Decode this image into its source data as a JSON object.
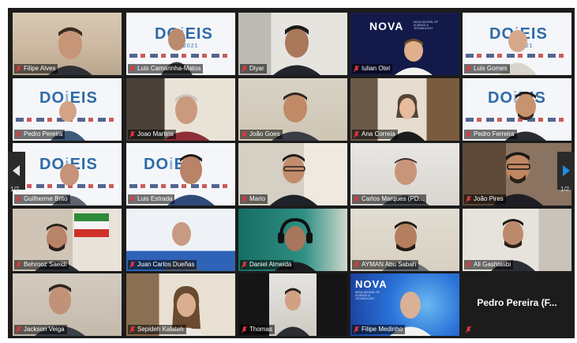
{
  "app": {
    "name": "Zoom gallery view"
  },
  "pagination": {
    "left_page": "1/2",
    "right_page": "1/2"
  },
  "participants": [
    {
      "name": "Filipe Alves",
      "background": "room",
      "muted": true
    },
    {
      "name": "Luis Camarinha-Matos",
      "background": "doceis-banner",
      "muted": true
    },
    {
      "name": "Diyar",
      "background": "room",
      "muted": true
    },
    {
      "name": "Iulian Otel",
      "background": "nova-banner",
      "muted": true
    },
    {
      "name": "Luis Gomes",
      "background": "doceis-banner",
      "muted": true
    },
    {
      "name": "Pedro Pereira",
      "background": "doceis-banner",
      "muted": true,
      "speaking": true
    },
    {
      "name": "Joao Martins",
      "background": "room",
      "muted": true
    },
    {
      "name": "João Goes",
      "background": "room",
      "muted": true
    },
    {
      "name": "Ana Correia",
      "background": "room",
      "muted": true
    },
    {
      "name": "Pedro Ferreira",
      "background": "doceis-banner",
      "muted": true
    },
    {
      "name": "Guilherme Brito",
      "background": "doceis-banner",
      "muted": true
    },
    {
      "name": "Luis Estrada",
      "background": "doceis-banner",
      "muted": true
    },
    {
      "name": "Mario",
      "background": "room",
      "muted": true
    },
    {
      "name": "Carlos Marques (PD...",
      "background": "room",
      "muted": true
    },
    {
      "name": "João Pires",
      "background": "room",
      "muted": true
    },
    {
      "name": "Behrooz Saeidi",
      "background": "room",
      "muted": true
    },
    {
      "name": "Juan Carlos Dueñas",
      "background": "blue-room",
      "muted": true
    },
    {
      "name": "Daniel Almeida",
      "background": "teal",
      "muted": true
    },
    {
      "name": "AYMAN Abu Sabah",
      "background": "room",
      "muted": true
    },
    {
      "name": "Ali Gashtasbi",
      "background": "room",
      "muted": true
    },
    {
      "name": "Jackson Veiga",
      "background": "room",
      "muted": true
    },
    {
      "name": "Sepideh Kalateh",
      "background": "room",
      "muted": true
    },
    {
      "name": "Thomas",
      "background": "dark",
      "muted": true
    },
    {
      "name": "Filipe Medinho",
      "background": "nova-blue",
      "muted": true
    },
    {
      "name": "Pedro Pereira (F...",
      "background": "no-video",
      "muted": true
    }
  ],
  "banner": {
    "logo_left": "DO",
    "logo_right": "EIS",
    "year": "2021",
    "nova": "NOVA"
  },
  "colors": {
    "stage": "#1c1c1c",
    "active_speaker": "#c6e33c",
    "mic_muted": "#e03a3a"
  }
}
